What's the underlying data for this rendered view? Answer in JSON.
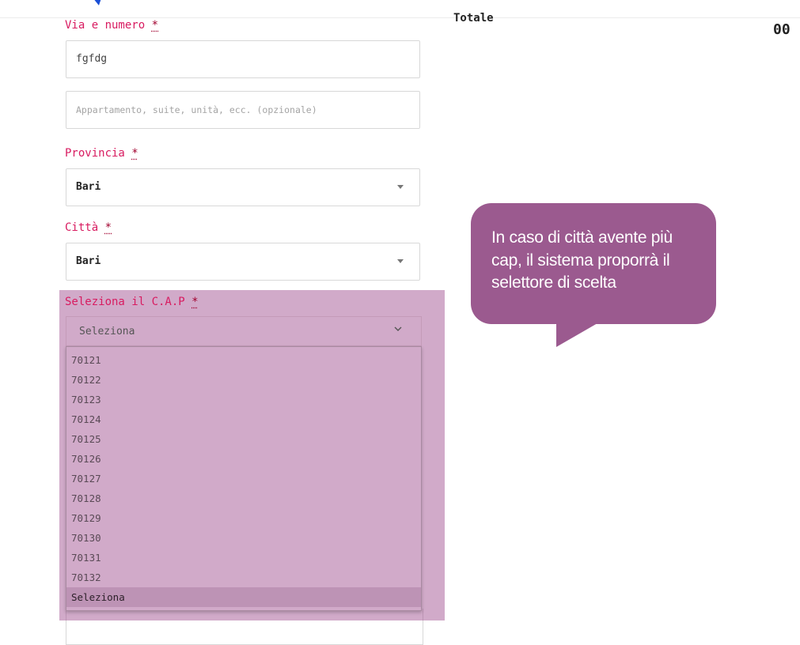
{
  "header": {
    "totale_label": "Totale",
    "total_value": "00"
  },
  "form": {
    "street": {
      "label": "Via e numero",
      "required": "*",
      "value": "fgfdg"
    },
    "apartment": {
      "placeholder": "Appartamento, suite, unità, ecc. (opzionale)"
    },
    "province": {
      "label": "Provincia",
      "required": "*",
      "value": "Bari"
    },
    "city": {
      "label": "Città",
      "required": "*",
      "value": "Bari"
    },
    "cap": {
      "label": "Seleziona il C.A.P",
      "required": "*",
      "value": "Seleziona",
      "options": [
        "70121",
        "70122",
        "70123",
        "70124",
        "70125",
        "70126",
        "70127",
        "70128",
        "70129",
        "70130",
        "70131",
        "70132",
        "Seleziona"
      ],
      "selected_index": 12
    }
  },
  "callout": {
    "text": "In caso di città avente più cap, il sistema proporrà il selettore di scelta",
    "color": "#9b5a8f"
  },
  "colors": {
    "label": "#d81b60",
    "required": "#a1002d",
    "highlight": "#9d4b8c"
  }
}
